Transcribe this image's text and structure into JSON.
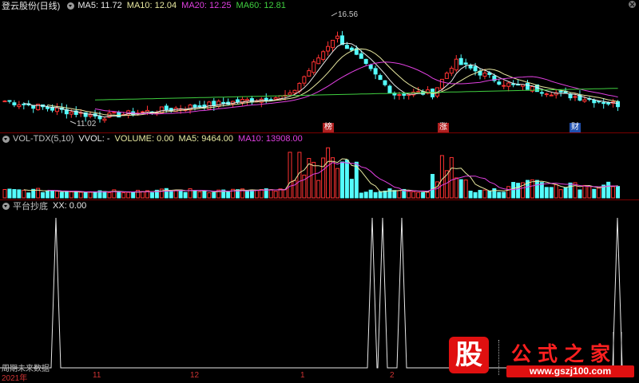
{
  "main_pane": {
    "stock_name": "登云股份(日线)",
    "indicators": [
      {
        "label": "MA5: 11.72",
        "color": "#e8e8e8"
      },
      {
        "label": "MA10: 12.04",
        "color": "#e8e8a0"
      },
      {
        "label": "MA20: 12.25",
        "color": "#e040e0"
      },
      {
        "label": "MA60: 12.81",
        "color": "#40d040"
      }
    ],
    "high_label": "16.56",
    "low_label": "11.02",
    "event_badges": [
      {
        "label": "榜",
        "color": "#b02020"
      },
      {
        "label": "涨",
        "color": "#b02020"
      },
      {
        "label": "财",
        "color": "#2050b0"
      }
    ],
    "y_range": [
      10.5,
      17.3
    ]
  },
  "volume_pane": {
    "title": "VOL-TDX(5,10)",
    "indicators": [
      {
        "label": "VVOL: -",
        "color": "#e8e8e8"
      },
      {
        "label": "VOLUME: 0.00",
        "color": "#e8e8a0"
      },
      {
        "label": "MA5: 9464.00",
        "color": "#e8e8a0"
      },
      {
        "label": "MA10: 13908.00",
        "color": "#e040e0"
      }
    ]
  },
  "signal_pane": {
    "title": "平台抄底",
    "indicators": [
      {
        "label": "XX: 0.00",
        "color": "#e8e8e8"
      }
    ]
  },
  "date_axis": [
    "2021年",
    "11",
    "12",
    "1",
    "2"
  ],
  "watermark": "周期未来数据",
  "logo": {
    "glyph": "股",
    "title": "公式之家",
    "url": "www.gszj100.com"
  },
  "colors": {
    "up": "#ff3232",
    "down": "#54fcfc",
    "grid": "#7a0000"
  }
}
